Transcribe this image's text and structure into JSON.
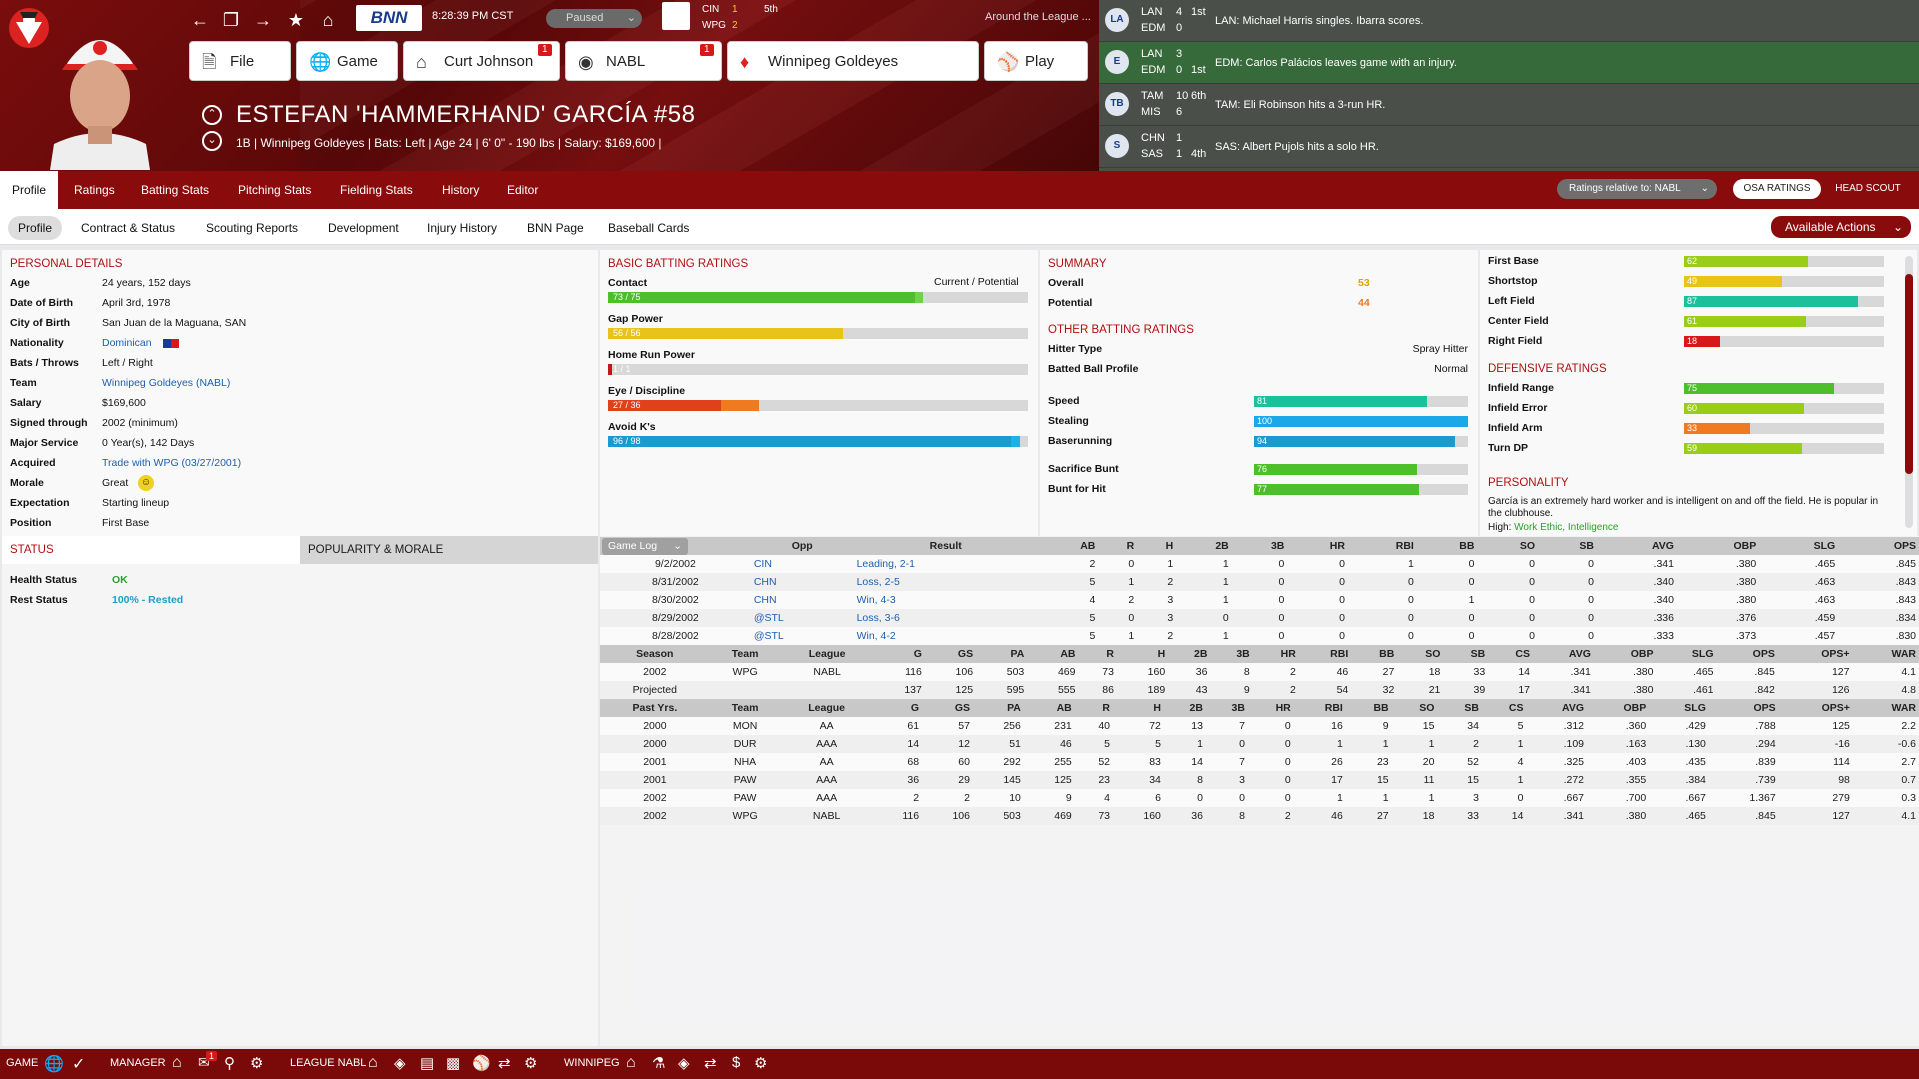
{
  "topbar": {
    "clock": "8:28:39  PM  CST",
    "sim_state": "Paused",
    "mini_score": {
      "team1": "CIN",
      "score1": "1",
      "team2": "WPG",
      "score2": "2",
      "inning": "5th"
    },
    "around_label": "Around the League ...",
    "file_label": "File",
    "game_label": "Game",
    "manager_label": "Curt Johnson",
    "manager_badge": "1",
    "league_label": "NABL",
    "league_badge": "1",
    "team_label": "Winnipeg Goldeyes",
    "play_label": "Play",
    "bnn_label": "BNN"
  },
  "player": {
    "name": "ESTEFAN 'HAMMERHAND' GARCÍA  #58",
    "line": "1B | Winnipeg Goldeyes  |  Bats: Left  |  Age 24  |  6' 0\" - 190 lbs  |  Salary: $169,600  |"
  },
  "ticker": [
    {
      "t1": "LAN",
      "s1": "4",
      "inn1": "1st",
      "t2": "EDM",
      "s2": "0",
      "inn2": "",
      "event": "LAN: Michael Harris singles. Ibarra scores.",
      "logo": "LA",
      "hl": false
    },
    {
      "t1": "LAN",
      "s1": "3",
      "inn1": "",
      "t2": "EDM",
      "s2": "0",
      "inn2": "1st",
      "event": "EDM: Carlos Palácios leaves game with an injury.",
      "logo": "E",
      "hl": true
    },
    {
      "t1": "TAM",
      "s1": "10",
      "inn1": "6th",
      "t2": "MIS",
      "s2": "6",
      "inn2": "",
      "event": "TAM: Eli Robinson hits a 3-run HR.",
      "logo": "TB",
      "hl": false
    },
    {
      "t1": "CHN",
      "s1": "1",
      "inn1": "",
      "t2": "SAS",
      "s2": "1",
      "inn2": "4th",
      "event": "SAS: Albert Pujols hits a solo HR.",
      "logo": "S",
      "hl": false
    }
  ],
  "tabs_main": [
    "Profile",
    "Ratings",
    "Batting Stats",
    "Pitching Stats",
    "Fielding Stats",
    "History",
    "Editor"
  ],
  "tabs_sub": [
    "Profile",
    "Contract & Status",
    "Scouting Reports",
    "Development",
    "Injury History",
    "BNN Page",
    "Baseball Cards"
  ],
  "ratings_relative": "Ratings relative to: NABL",
  "osa_label": "OSA RATINGS",
  "scout_label": "HEAD SCOUT",
  "actions_label": "Available Actions",
  "personal": {
    "title": "PERSONAL DETAILS",
    "rows": [
      {
        "label": "Age",
        "value": "24 years, 152 days"
      },
      {
        "label": "Date of Birth",
        "value": "April 3rd, 1978"
      },
      {
        "label": "City of Birth",
        "value": "San Juan de la Maguana, SAN"
      },
      {
        "label": "Nationality",
        "value": "Dominican",
        "link": true
      },
      {
        "label": "Bats / Throws",
        "value": "Left / Right"
      },
      {
        "label": "Team",
        "value": "Winnipeg Goldeyes (NABL)",
        "link": true
      },
      {
        "label": "Salary",
        "value": "$169,600"
      },
      {
        "label": "Signed through",
        "value": "2002 (minimum)"
      },
      {
        "label": "Major Service",
        "value": "0 Year(s), 142 Days"
      },
      {
        "label": "Acquired",
        "value": "Trade with WPG (03/27/2001)",
        "link": true
      },
      {
        "label": "Morale",
        "value": "Great"
      },
      {
        "label": "Expectation",
        "value": "Starting lineup"
      },
      {
        "label": "Position",
        "value": "First Base"
      }
    ]
  },
  "status": {
    "title": "STATUS",
    "popularity_tab": "POPULARITY & MORALE",
    "health_label": "Health Status",
    "health_value": "OK",
    "rest_label": "Rest Status",
    "rest_value": "100% - Rested"
  },
  "batting": {
    "title": "BASIC BATTING RATINGS",
    "header_right": "Current / Potential",
    "rows": [
      {
        "label": "Contact",
        "text": "73 / 75",
        "current": 73,
        "potential": 75,
        "color": "#4cbf2a",
        "color2": "#6fd24a"
      },
      {
        "label": "Gap Power",
        "text": "56 / 56",
        "current": 56,
        "potential": 56,
        "color": "#e8c41a",
        "color2": "#e8c41a"
      },
      {
        "label": "Home Run Power",
        "text": "1 / 1",
        "current": 1,
        "potential": 1,
        "color": "#c01818",
        "color2": "#c01818"
      },
      {
        "label": "Eye / Discipline",
        "text": "27 / 36",
        "current": 27,
        "potential": 36,
        "color": "#e0401a",
        "color2": "#f07a20"
      },
      {
        "label": "Avoid K's",
        "text": "96 / 98",
        "current": 96,
        "potential": 98,
        "color": "#1a9bd0",
        "color2": "#20b0e8"
      }
    ]
  },
  "summary": {
    "title": "SUMMARY",
    "overall_label": "Overall",
    "overall_value": "53",
    "potential_label": "Potential",
    "potential_value": "44",
    "other_title": "OTHER BATTING RATINGS",
    "hitter_type_label": "Hitter Type",
    "hitter_type_value": "Spray Hitter",
    "bbp_label": "Batted Ball Profile",
    "bbp_value": "Normal",
    "speed_rows": [
      {
        "label": "Speed",
        "value": 81,
        "color": "#1cc09a"
      },
      {
        "label": "Stealing",
        "value": 100,
        "color": "#1aa8e8"
      },
      {
        "label": "Baserunning",
        "value": 94,
        "color": "#1a9bd0"
      },
      {
        "label": "Sacrifice Bunt",
        "value": 76,
        "color": "#4cbf2a"
      },
      {
        "label": "Bunt for Hit",
        "value": 77,
        "color": "#4cbf2a"
      }
    ]
  },
  "fielding": {
    "positions": [
      {
        "label": "First Base",
        "value": 62,
        "color": "#9acd1a"
      },
      {
        "label": "Shortstop",
        "value": 49,
        "color": "#e8c41a"
      },
      {
        "label": "Left Field",
        "value": 87,
        "color": "#1cc09a"
      },
      {
        "label": "Center Field",
        "value": 61,
        "color": "#9acd1a"
      },
      {
        "label": "Right Field",
        "value": 18,
        "color": "#d81818"
      }
    ],
    "def_title": "DEFENSIVE RATINGS",
    "defense": [
      {
        "label": "Infield Range",
        "value": 75,
        "color": "#4cbf2a"
      },
      {
        "label": "Infield Error",
        "value": 60,
        "color": "#9acd1a"
      },
      {
        "label": "Infield Arm",
        "value": 33,
        "color": "#f07a20"
      },
      {
        "label": "Turn DP",
        "value": 59,
        "color": "#9acd1a"
      }
    ],
    "personality_title": "PERSONALITY",
    "personality_text": "García is an extremely hard worker and is intelligent on and off the field. He is popular in the clubhouse.",
    "personality_high_label": "High:",
    "personality_high_value": "Work Ethic, Intelligence"
  },
  "game_log": {
    "selector": "Game Log",
    "headers": [
      "Opp",
      "Result",
      "AB",
      "R",
      "H",
      "2B",
      "3B",
      "HR",
      "RBI",
      "BB",
      "SO",
      "SB",
      "AVG",
      "OBP",
      "SLG",
      "OPS"
    ],
    "rows": [
      [
        "9/2/2002",
        "CIN",
        "Leading, 2-1",
        "2",
        "0",
        "1",
        "1",
        "0",
        "0",
        "1",
        "0",
        "0",
        "0",
        ".341",
        ".380",
        ".465",
        ".845"
      ],
      [
        "8/31/2002",
        "CHN",
        "Loss, 2-5",
        "5",
        "1",
        "2",
        "1",
        "0",
        "0",
        "0",
        "0",
        "0",
        "0",
        ".340",
        ".380",
        ".463",
        ".843"
      ],
      [
        "8/30/2002",
        "CHN",
        "Win, 4-3",
        "4",
        "2",
        "3",
        "1",
        "0",
        "0",
        "0",
        "1",
        "0",
        "0",
        ".340",
        ".380",
        ".463",
        ".843"
      ],
      [
        "8/29/2002",
        "@STL",
        "Loss, 3-6",
        "5",
        "0",
        "3",
        "0",
        "0",
        "0",
        "0",
        "0",
        "0",
        "0",
        ".336",
        ".376",
        ".459",
        ".834"
      ],
      [
        "8/28/2002",
        "@STL",
        "Win, 4-2",
        "5",
        "1",
        "2",
        "1",
        "0",
        "0",
        "0",
        "0",
        "0",
        "0",
        ".333",
        ".373",
        ".457",
        ".830"
      ]
    ]
  },
  "season": {
    "headers": [
      "Season",
      "Team",
      "League",
      "G",
      "GS",
      "PA",
      "AB",
      "R",
      "H",
      "2B",
      "3B",
      "HR",
      "RBI",
      "BB",
      "SO",
      "SB",
      "CS",
      "AVG",
      "OBP",
      "SLG",
      "OPS",
      "OPS+",
      "WAR"
    ],
    "rows": [
      [
        "2002",
        "WPG",
        "NABL",
        "116",
        "106",
        "503",
        "469",
        "73",
        "160",
        "36",
        "8",
        "2",
        "46",
        "27",
        "18",
        "33",
        "14",
        ".341",
        ".380",
        ".465",
        ".845",
        "127",
        "4.1"
      ],
      [
        "Projected",
        "",
        "",
        "137",
        "125",
        "595",
        "555",
        "86",
        "189",
        "43",
        "9",
        "2",
        "54",
        "32",
        "21",
        "39",
        "17",
        ".341",
        ".380",
        ".461",
        ".842",
        "126",
        "4.8"
      ]
    ]
  },
  "past": {
    "headers": [
      "Past Yrs.",
      "Team",
      "League",
      "G",
      "GS",
      "PA",
      "AB",
      "R",
      "H",
      "2B",
      "3B",
      "HR",
      "RBI",
      "BB",
      "SO",
      "SB",
      "CS",
      "AVG",
      "OBP",
      "SLG",
      "OPS",
      "OPS+",
      "WAR"
    ],
    "rows": [
      [
        "2000",
        "MON",
        "AA",
        "61",
        "57",
        "256",
        "231",
        "40",
        "72",
        "13",
        "7",
        "0",
        "16",
        "9",
        "15",
        "34",
        "5",
        ".312",
        ".360",
        ".429",
        ".788",
        "125",
        "2.2"
      ],
      [
        "2000",
        "DUR",
        "AAA",
        "14",
        "12",
        "51",
        "46",
        "5",
        "5",
        "1",
        "0",
        "0",
        "1",
        "1",
        "1",
        "2",
        "1",
        ".109",
        ".163",
        ".130",
        ".294",
        "-16",
        "-0.6"
      ],
      [
        "2001",
        "NHA",
        "AA",
        "68",
        "60",
        "292",
        "255",
        "52",
        "83",
        "14",
        "7",
        "0",
        "26",
        "23",
        "20",
        "52",
        "4",
        ".325",
        ".403",
        ".435",
        ".839",
        "114",
        "2.7"
      ],
      [
        "2001",
        "PAW",
        "AAA",
        "36",
        "29",
        "145",
        "125",
        "23",
        "34",
        "8",
        "3",
        "0",
        "17",
        "15",
        "11",
        "15",
        "1",
        ".272",
        ".355",
        ".384",
        ".739",
        "98",
        "0.7"
      ],
      [
        "2002",
        "PAW",
        "AAA",
        "2",
        "2",
        "10",
        "9",
        "4",
        "6",
        "0",
        "0",
        "0",
        "1",
        "1",
        "1",
        "3",
        "0",
        ".667",
        ".700",
        ".667",
        "1.367",
        "279",
        "0.3"
      ],
      [
        "2002",
        "WPG",
        "NABL",
        "116",
        "106",
        "503",
        "469",
        "73",
        "160",
        "36",
        "8",
        "2",
        "46",
        "27",
        "18",
        "33",
        "14",
        ".341",
        ".380",
        ".465",
        ".845",
        "127",
        "4.1"
      ]
    ]
  },
  "bottom": {
    "game": "GAME",
    "manager": "MANAGER",
    "manager_badge": "1",
    "league": "LEAGUE NABL",
    "team": "WINNIPEG"
  },
  "colors": {
    "brand": "#8a0b0b",
    "accent": "#b01010",
    "ticker_bg": "#4a4f4a",
    "ticker_hl": "#376a3a"
  }
}
